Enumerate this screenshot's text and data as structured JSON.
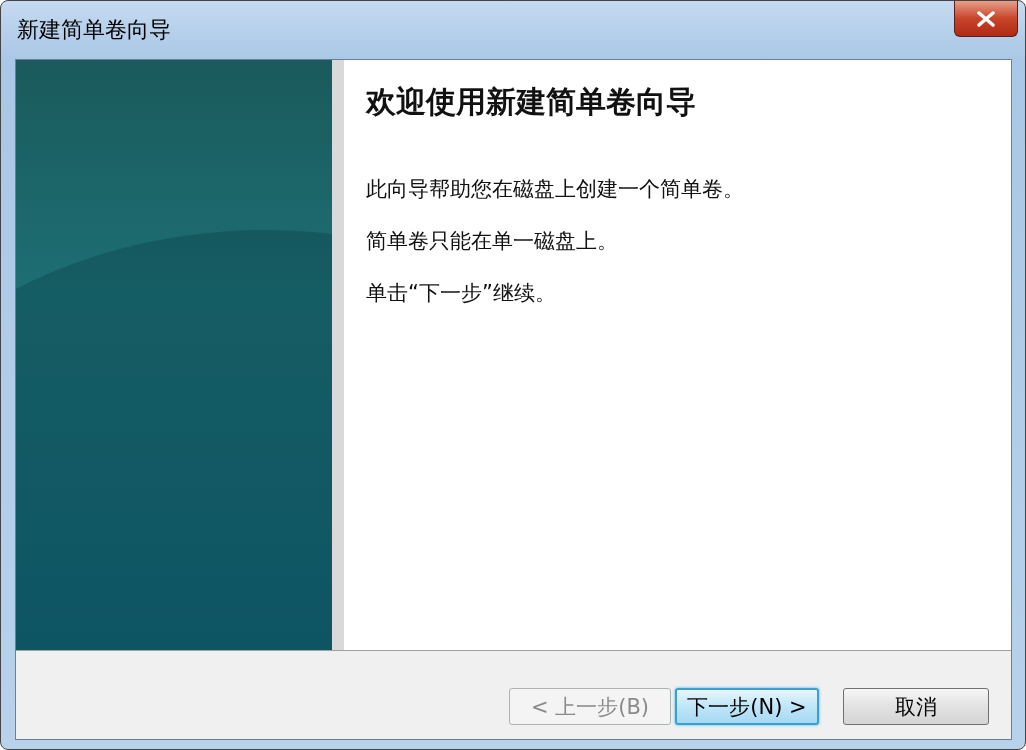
{
  "window": {
    "title": "新建简单卷向导"
  },
  "heading": "欢迎使用新建简单卷向导",
  "paragraphs": [
    "此向导帮助您在磁盘上创建一个简单卷。",
    "简单卷只能在单一磁盘上。",
    "单击“下一步”继续。"
  ],
  "buttons": [
    {
      "label": "< 上一步(B)",
      "disabled": true,
      "default": false
    },
    {
      "label": "下一步(N) >",
      "disabled": false,
      "default": true
    },
    {
      "label": "取消",
      "disabled": false,
      "default": false
    }
  ]
}
